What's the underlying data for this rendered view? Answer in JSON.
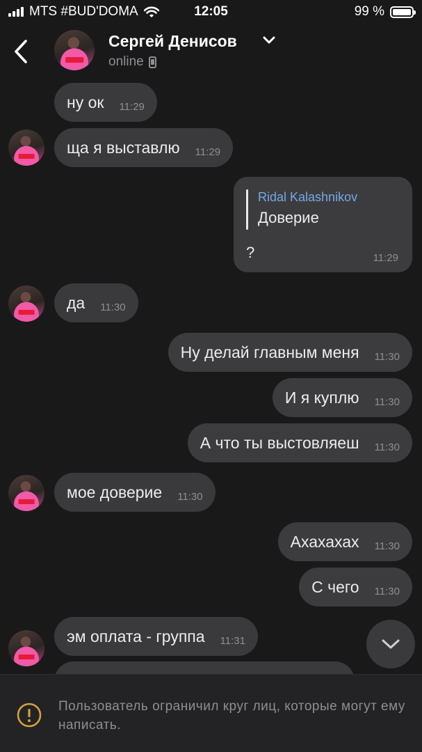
{
  "status_bar": {
    "carrier": "MTS #BUD'DOMA",
    "time": "12:05",
    "battery": "99 %",
    "battery_level": 0.99
  },
  "header": {
    "contact_name": "Сергей Денисов",
    "presence": "online",
    "icons": [
      "back-arrow-icon",
      "chevron-down-icon",
      "mobile-phone-icon"
    ]
  },
  "messages": [
    {
      "dir": "in",
      "text": "ну ок",
      "time": "11:29",
      "avatar": false
    },
    {
      "dir": "in",
      "text": "ща я выставлю",
      "time": "11:29",
      "avatar": true
    },
    {
      "dir": "out",
      "reply_to_author": "Ridal Kalashnikov",
      "reply_to_text": "Доверие",
      "text": "?",
      "time": "11:29"
    },
    {
      "dir": "in",
      "text": "да",
      "time": "11:30",
      "avatar": true
    },
    {
      "dir": "out",
      "text": "Ну делай главным меня",
      "time": "11:30"
    },
    {
      "dir": "out",
      "text": "И я куплю",
      "time": "11:30"
    },
    {
      "dir": "out",
      "text": "А что ты выстовляеш",
      "time": "11:30"
    },
    {
      "dir": "in",
      "text": "мое доверие",
      "time": "11:30",
      "avatar": true
    },
    {
      "dir": "out",
      "text": "Ахахахах",
      "time": "11:30"
    },
    {
      "dir": "out",
      "text": "С чего",
      "time": "11:30"
    },
    {
      "dir": "in",
      "text": "эм оплата - группа",
      "time": "11:31",
      "avatar": true
    }
  ],
  "footer": {
    "notice": "Пользователь ограничил круг лиц, которые могут ему написать.",
    "icon": "warning-icon"
  },
  "colors": {
    "background": "#191919",
    "bubble": "#3a3a3c",
    "reply_author": "#76a9e6",
    "warning": "#d4a23a"
  }
}
